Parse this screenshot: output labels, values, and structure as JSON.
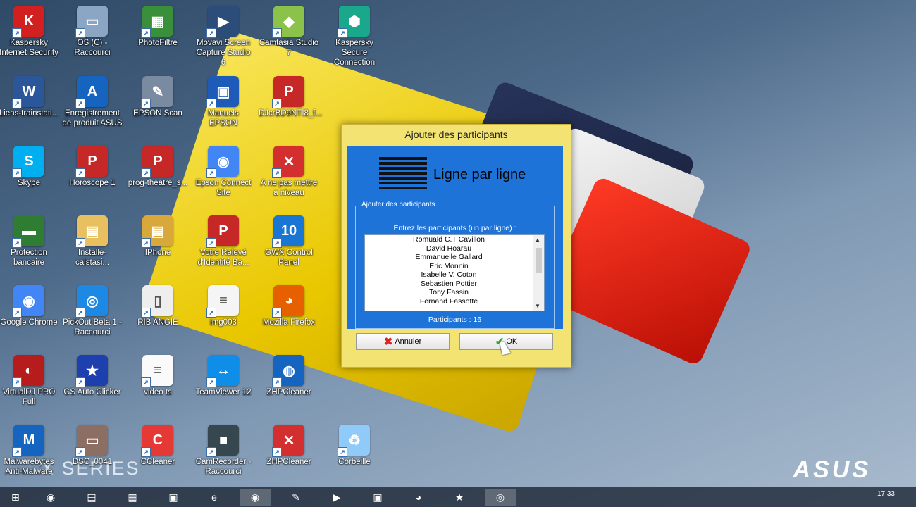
{
  "desktop": {
    "xseries": "X SERIES",
    "asus_logo": "ASUS",
    "icons": [
      {
        "label": "Kaspersky Internet Security",
        "icon": "kaspersky-icon",
        "color": "#d21f1f",
        "glyph": "K"
      },
      {
        "label": "OS (C) - Raccourci",
        "icon": "drive-icon",
        "color": "#8aa6c4",
        "glyph": "▭"
      },
      {
        "label": "PhotoFiltre",
        "icon": "photofiltre-icon",
        "color": "#3a8f3a",
        "glyph": "▦"
      },
      {
        "label": "Movavi Screen Capture Studio 6",
        "icon": "movavi-icon",
        "color": "#2c4d7a",
        "glyph": "▶"
      },
      {
        "label": "Camtasia Studio 7",
        "icon": "camtasia-icon",
        "color": "#8bc34a",
        "glyph": "◆"
      },
      {
        "label": "Kaspersky Secure Connection",
        "icon": "kaspersky-vpn-icon",
        "color": "#1aa88c",
        "glyph": "⬢"
      },
      {
        "label": "Liens-trainstati...",
        "icon": "word-document-icon",
        "color": "#2b579a",
        "glyph": "W"
      },
      {
        "label": "Enregistrement de produit ASUS",
        "icon": "asus-register-icon",
        "color": "#1565c0",
        "glyph": "A"
      },
      {
        "label": "EPSON Scan",
        "icon": "scanner-icon",
        "color": "#7a8aa0",
        "glyph": "✎"
      },
      {
        "label": "Manuels EPSON",
        "icon": "epson-manual-icon",
        "color": "#1e5bb8",
        "glyph": "▣"
      },
      {
        "label": "DJcrBD9NTI8_f...",
        "icon": "pdf-file-icon",
        "color": "#c62828",
        "glyph": "P"
      },
      {
        "label": "Skype",
        "icon": "skype-icon",
        "color": "#00aff0",
        "glyph": "S"
      },
      {
        "label": "Horoscope 1",
        "icon": "pdf-file-icon",
        "color": "#c62828",
        "glyph": "P"
      },
      {
        "label": "prog-theatre_s...",
        "icon": "pdf-file-icon",
        "color": "#c62828",
        "glyph": "P"
      },
      {
        "label": "Epson Connect Site",
        "icon": "chrome-icon",
        "color": "#4285f4",
        "glyph": "◉"
      },
      {
        "label": "A ne pas mettre a niveau",
        "icon": "image-file-icon",
        "color": "#d32f2f",
        "glyph": "✕"
      },
      {
        "label": "Protection bancaire",
        "icon": "bank-card-icon",
        "color": "#2e7d32",
        "glyph": "▬"
      },
      {
        "label": "Installe-calstasi...",
        "icon": "folder-icon",
        "color": "#e8c060",
        "glyph": "▤"
      },
      {
        "label": "IPhone",
        "icon": "folder-icon",
        "color": "#d9a83a",
        "glyph": "▤"
      },
      {
        "label": "Votre Relevé d'Identité Ba...",
        "icon": "pdf-file-icon",
        "color": "#c62828",
        "glyph": "P"
      },
      {
        "label": "GWX Control Panel",
        "icon": "gwx-icon",
        "color": "#1976d2",
        "glyph": "10"
      },
      {
        "label": "Google Chrome",
        "icon": "chrome-icon",
        "color": "#4285f4",
        "glyph": "◉"
      },
      {
        "label": "PickOut Beta 1 - Raccourci",
        "icon": "pickout-icon",
        "color": "#1e88e5",
        "glyph": "◎"
      },
      {
        "label": "RIB ANGIE",
        "icon": "document-icon",
        "color": "#eeeeee",
        "glyph": "▯"
      },
      {
        "label": "img003",
        "icon": "image-document-icon",
        "color": "#f5f5f5",
        "glyph": "≡"
      },
      {
        "label": "Mozilla Firefox",
        "icon": "firefox-icon",
        "color": "#e66000",
        "glyph": "◕"
      },
      {
        "label": "VirtualDJ PRO Full",
        "icon": "virtualdj-icon",
        "color": "#b71c1c",
        "glyph": "◐"
      },
      {
        "label": "GS Auto Clicker",
        "icon": "star-icon",
        "color": "#1e40af",
        "glyph": "★"
      },
      {
        "label": "video ts",
        "icon": "text-file-icon",
        "color": "#fafafa",
        "glyph": "≡"
      },
      {
        "label": "TeamViewer 12",
        "icon": "teamviewer-icon",
        "color": "#0e8ee9",
        "glyph": "↔"
      },
      {
        "label": "ZHPCleaner",
        "icon": "zhpcleaner-icon",
        "color": "#1565c0",
        "glyph": "◍"
      },
      {
        "label": "Malwarebytes Anti-Malware",
        "icon": "malwarebytes-icon",
        "color": "#1565c0",
        "glyph": "M"
      },
      {
        "label": "DSC_0041",
        "icon": "photo-thumbnail-icon",
        "color": "#8d6e63",
        "glyph": "▭"
      },
      {
        "label": "CCleaner",
        "icon": "ccleaner-icon",
        "color": "#e53935",
        "glyph": "C"
      },
      {
        "label": "CamRecorder - Raccourci",
        "icon": "camcorder-icon",
        "color": "#37474f",
        "glyph": "■"
      },
      {
        "label": "ZHPCleaner",
        "icon": "image-file-icon",
        "color": "#d32f2f",
        "glyph": "✕"
      },
      {
        "label": "Corbeille",
        "icon": "recycle-bin-icon",
        "color": "#90caf9",
        "glyph": "♻"
      }
    ]
  },
  "dialog": {
    "title": "Ajouter des participants",
    "heading": "Ligne par ligne",
    "group_legend": "Ajouter des participants",
    "prompt": "Entrez les participants (un par ligne) :",
    "participants": [
      "Romuald C.T Cavillon",
      "David Hoarau",
      "Emmanuelle Gallard",
      "Eric Monnin",
      "Isabelle V. Coton",
      "Sebastien Pottier",
      "Tony Fassin",
      "Fernand Fassotte"
    ],
    "count_label": "Participants : 16",
    "cancel_label": "Annuler",
    "ok_label": "OK"
  },
  "taskbar": {
    "items": [
      {
        "icon": "windows-start-icon",
        "glyph": "⊞"
      },
      {
        "icon": "chrome-icon",
        "glyph": "◉"
      },
      {
        "icon": "file-explorer-icon",
        "glyph": "▤"
      },
      {
        "icon": "archive-icon",
        "glyph": "▦"
      },
      {
        "icon": "store-icon",
        "glyph": "▣"
      },
      {
        "icon": "internet-explorer-icon",
        "glyph": "e"
      },
      {
        "icon": "chrome-icon",
        "glyph": "◉"
      },
      {
        "icon": "scanner-icon",
        "glyph": "✎"
      },
      {
        "icon": "media-player-icon",
        "glyph": "▶"
      },
      {
        "icon": "movavi-icon",
        "glyph": "▣"
      },
      {
        "icon": "firefox-icon",
        "glyph": "◕"
      },
      {
        "icon": "star-icon",
        "glyph": "★"
      },
      {
        "icon": "pickout-icon",
        "glyph": "◎"
      }
    ],
    "clock_time": "17:33"
  }
}
